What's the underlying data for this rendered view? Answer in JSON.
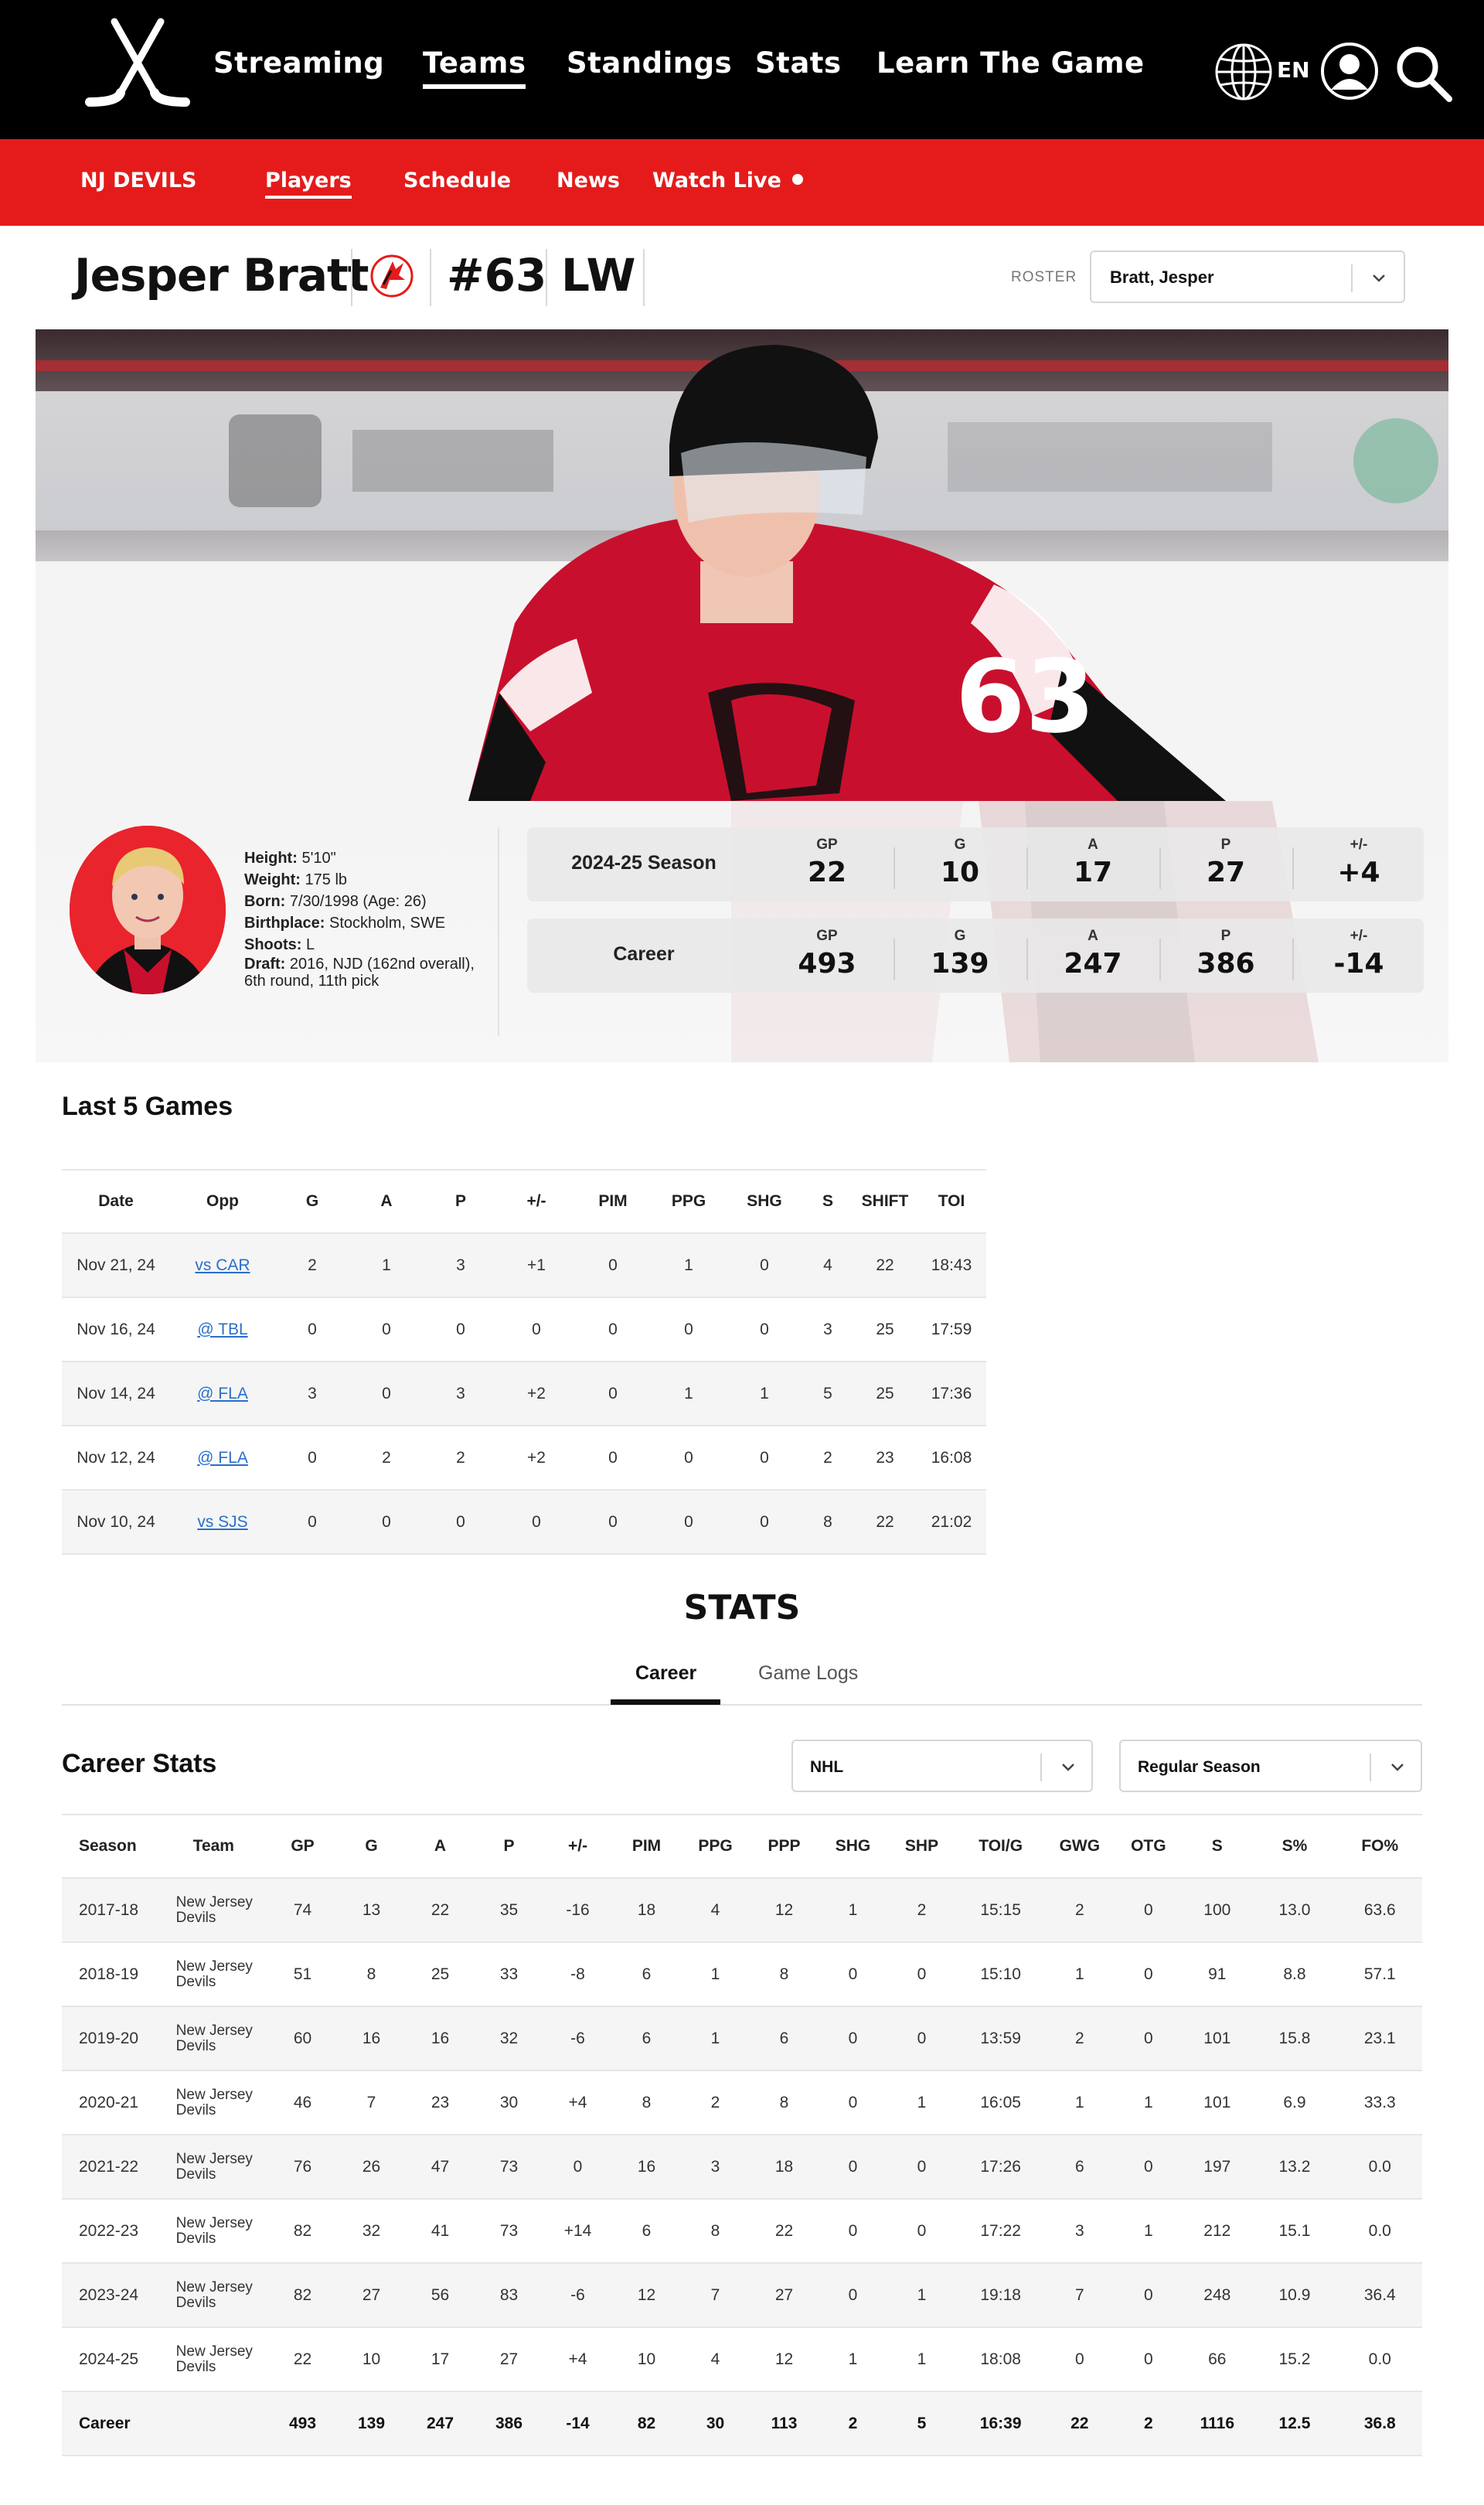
{
  "nav": {
    "items": [
      "Streaming",
      "Teams",
      "Standings",
      "Stats",
      "Learn The Game"
    ],
    "active": "Teams",
    "lang": "EN"
  },
  "team_nav": {
    "team": "NJ DEVILS",
    "items": [
      "Players",
      "Schedule",
      "News",
      "Watch Live"
    ],
    "active": "Players"
  },
  "player": {
    "name": "Jesper Bratt",
    "number": "#63",
    "position": "LW",
    "roster_label": "ROSTER",
    "roster_value": "Bratt, Jesper",
    "bio": {
      "height_label": "Height:",
      "height": "5'10\"",
      "weight_label": "Weight:",
      "weight": "175 lb",
      "born_label": "Born:",
      "born": "7/30/1998 (Age: 26)",
      "birthplace_label": "Birthplace:",
      "birthplace": "Stockholm, SWE",
      "shoots_label": "Shoots:",
      "shoots": "L",
      "draft_label": "Draft:",
      "draft": "2016, NJD (162nd overall), 6th round, 11th pick"
    }
  },
  "summary": {
    "headers": [
      "GP",
      "G",
      "A",
      "P",
      "+/-"
    ],
    "rows": [
      {
        "label": "2024-25 Season",
        "values": [
          "22",
          "10",
          "17",
          "27",
          "+4"
        ]
      },
      {
        "label": "Career",
        "values": [
          "493",
          "139",
          "247",
          "386",
          "-14"
        ]
      }
    ]
  },
  "last5": {
    "title": "Last 5 Games",
    "headers": [
      "Date",
      "Opp",
      "G",
      "A",
      "P",
      "+/-",
      "PIM",
      "PPG",
      "SHG",
      "S",
      "SHIFT",
      "TOI"
    ],
    "rows": [
      [
        "Nov 21, 24",
        "vs CAR",
        "2",
        "1",
        "3",
        "+1",
        "0",
        "1",
        "0",
        "4",
        "22",
        "18:43"
      ],
      [
        "Nov 16, 24",
        "@ TBL",
        "0",
        "0",
        "0",
        "0",
        "0",
        "0",
        "0",
        "3",
        "25",
        "17:59"
      ],
      [
        "Nov 14, 24",
        "@ FLA",
        "3",
        "0",
        "3",
        "+2",
        "0",
        "1",
        "1",
        "5",
        "25",
        "17:36"
      ],
      [
        "Nov 12, 24",
        "@ FLA",
        "0",
        "2",
        "2",
        "+2",
        "0",
        "0",
        "0",
        "2",
        "23",
        "16:08"
      ],
      [
        "Nov 10, 24",
        "vs SJS",
        "0",
        "0",
        "0",
        "0",
        "0",
        "0",
        "0",
        "8",
        "22",
        "21:02"
      ]
    ]
  },
  "stats": {
    "title": "STATS",
    "tabs": [
      "Career",
      "Game Logs"
    ],
    "active_tab": "Career",
    "career_title": "Career Stats",
    "league_select": "NHL",
    "season_select": "Regular Season",
    "headers": [
      "Season",
      "Team",
      "GP",
      "G",
      "A",
      "P",
      "+/-",
      "PIM",
      "PPG",
      "PPP",
      "SHG",
      "SHP",
      "TOI/G",
      "GWG",
      "OTG",
      "S",
      "S%",
      "FO%"
    ],
    "rows": [
      [
        "2017-18",
        "New Jersey Devils",
        "74",
        "13",
        "22",
        "35",
        "-16",
        "18",
        "4",
        "12",
        "1",
        "2",
        "15:15",
        "2",
        "0",
        "100",
        "13.0",
        "63.6"
      ],
      [
        "2018-19",
        "New Jersey Devils",
        "51",
        "8",
        "25",
        "33",
        "-8",
        "6",
        "1",
        "8",
        "0",
        "0",
        "15:10",
        "1",
        "0",
        "91",
        "8.8",
        "57.1"
      ],
      [
        "2019-20",
        "New Jersey Devils",
        "60",
        "16",
        "16",
        "32",
        "-6",
        "6",
        "1",
        "6",
        "0",
        "0",
        "13:59",
        "2",
        "0",
        "101",
        "15.8",
        "23.1"
      ],
      [
        "2020-21",
        "New Jersey Devils",
        "46",
        "7",
        "23",
        "30",
        "+4",
        "8",
        "2",
        "8",
        "0",
        "1",
        "16:05",
        "1",
        "1",
        "101",
        "6.9",
        "33.3"
      ],
      [
        "2021-22",
        "New Jersey Devils",
        "76",
        "26",
        "47",
        "73",
        "0",
        "16",
        "3",
        "18",
        "0",
        "0",
        "17:26",
        "6",
        "0",
        "197",
        "13.2",
        "0.0"
      ],
      [
        "2022-23",
        "New Jersey Devils",
        "82",
        "32",
        "41",
        "73",
        "+14",
        "6",
        "8",
        "22",
        "0",
        "0",
        "17:22",
        "3",
        "1",
        "212",
        "15.1",
        "0.0"
      ],
      [
        "2023-24",
        "New Jersey Devils",
        "82",
        "27",
        "56",
        "83",
        "-6",
        "12",
        "7",
        "27",
        "0",
        "1",
        "19:18",
        "7",
        "0",
        "248",
        "10.9",
        "36.4"
      ],
      [
        "2024-25",
        "New Jersey Devils",
        "22",
        "10",
        "17",
        "27",
        "+4",
        "10",
        "4",
        "12",
        "1",
        "1",
        "18:08",
        "0",
        "0",
        "66",
        "15.2",
        "0.0"
      ]
    ],
    "total": [
      "Career",
      "",
      "493",
      "139",
      "247",
      "386",
      "-14",
      "82",
      "30",
      "113",
      "2",
      "5",
      "16:39",
      "22",
      "2",
      "1116",
      "12.5",
      "36.8"
    ]
  },
  "colors": {
    "topbar": "#000000",
    "team_red": "#e51b1b",
    "link": "#2a6fc9"
  },
  "icons": [
    "hockey-sticks-logo",
    "globe-icon",
    "user-icon",
    "search-icon",
    "devils-logo-icon",
    "chevron-down-icon"
  ]
}
